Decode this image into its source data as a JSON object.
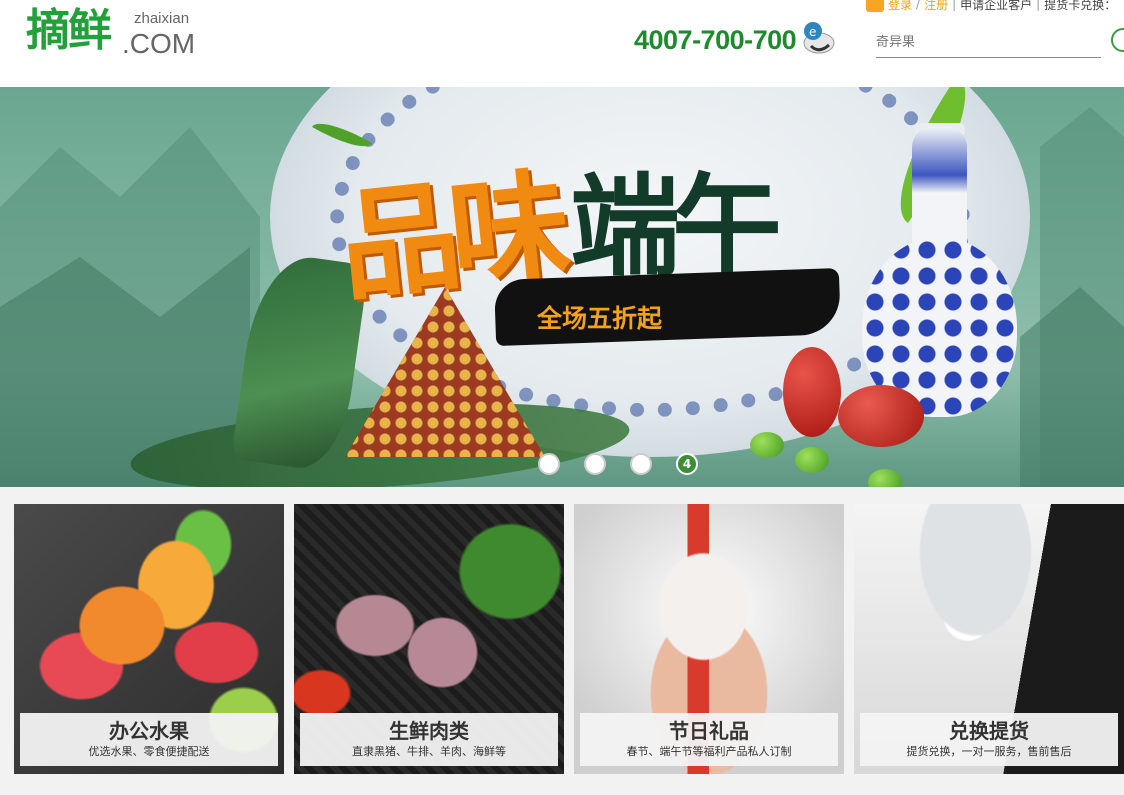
{
  "header": {
    "logo_cn": "摘鲜",
    "logo_pinyin": "zhaixian",
    "logo_com": ".COM",
    "hotline": "4007-700-700",
    "topbar": {
      "login": "登录",
      "register": "注册",
      "apply_enterprise": "申请企业客户",
      "redeem": "提货卡兑换："
    },
    "search": {
      "placeholder": "奇异果"
    }
  },
  "banner": {
    "title_part1": "品味",
    "title_part2": "端午",
    "sale_text": "全场五折起",
    "slides": [
      "",
      "",
      "",
      "4"
    ],
    "active_slide": 4
  },
  "cards": [
    {
      "title": "办公水果",
      "subtitle": "优选水果、零食便捷配送"
    },
    {
      "title": "生鲜肉类",
      "subtitle": "直隶黑猪、牛排、羊肉、海鲜等"
    },
    {
      "title": "节日礼品",
      "subtitle": "春节、端午节等福利产品私人订制"
    },
    {
      "title": "兑换提货",
      "subtitle": "提货兑换，一对一服务，售前售后"
    }
  ],
  "colors": {
    "brand_green": "#23a03a",
    "hotline_green": "#1d8a2e",
    "sale_orange": "#f6a11b"
  }
}
